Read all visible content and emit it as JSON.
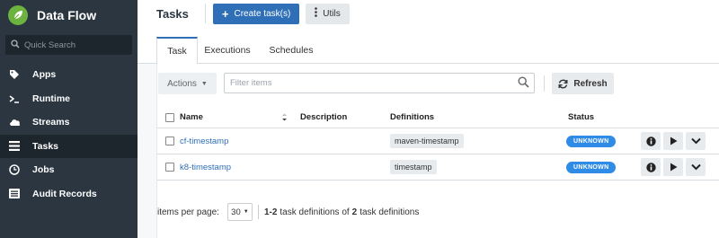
{
  "sidebar": {
    "brand": "Data Flow",
    "search_placeholder": "Quick Search",
    "items": [
      {
        "label": "Apps",
        "icon": "tag-icon"
      },
      {
        "label": "Runtime",
        "icon": "terminal-icon"
      },
      {
        "label": "Streams",
        "icon": "cloud-icon"
      },
      {
        "label": "Tasks",
        "icon": "tasks-icon"
      },
      {
        "label": "Jobs",
        "icon": "clock-icon"
      },
      {
        "label": "Audit Records",
        "icon": "list-icon"
      }
    ],
    "active_item": "Tasks"
  },
  "header": {
    "title": "Tasks",
    "create_label": "Create task(s)",
    "utils_label": "Utils"
  },
  "tabs": [
    {
      "label": "Task",
      "active": true
    },
    {
      "label": "Executions",
      "active": false
    },
    {
      "label": "Schedules",
      "active": false
    }
  ],
  "toolbar": {
    "actions_label": "Actions",
    "filter_placeholder": "Filter items",
    "refresh_label": "Refresh"
  },
  "table": {
    "columns": {
      "name": "Name",
      "description": "Description",
      "definitions": "Definitions",
      "status": "Status"
    },
    "rows": [
      {
        "name": "cf-timestamp",
        "description": "",
        "definition": "maven-timestamp",
        "status": "UNKNOWN"
      },
      {
        "name": "k8-timestamp",
        "description": "",
        "definition": "timestamp",
        "status": "UNKNOWN"
      }
    ]
  },
  "pagination": {
    "items_per_page_label": "items per page:",
    "page_size": "30",
    "range": "1-2",
    "summary_middle": "task definitions of",
    "total": "2",
    "summary_end": "task definitions"
  },
  "colors": {
    "sidebar_bg": "#2b3640",
    "primary": "#2e6fb7",
    "status_unknown": "#2e8be6",
    "brand_green": "#6db33f"
  }
}
